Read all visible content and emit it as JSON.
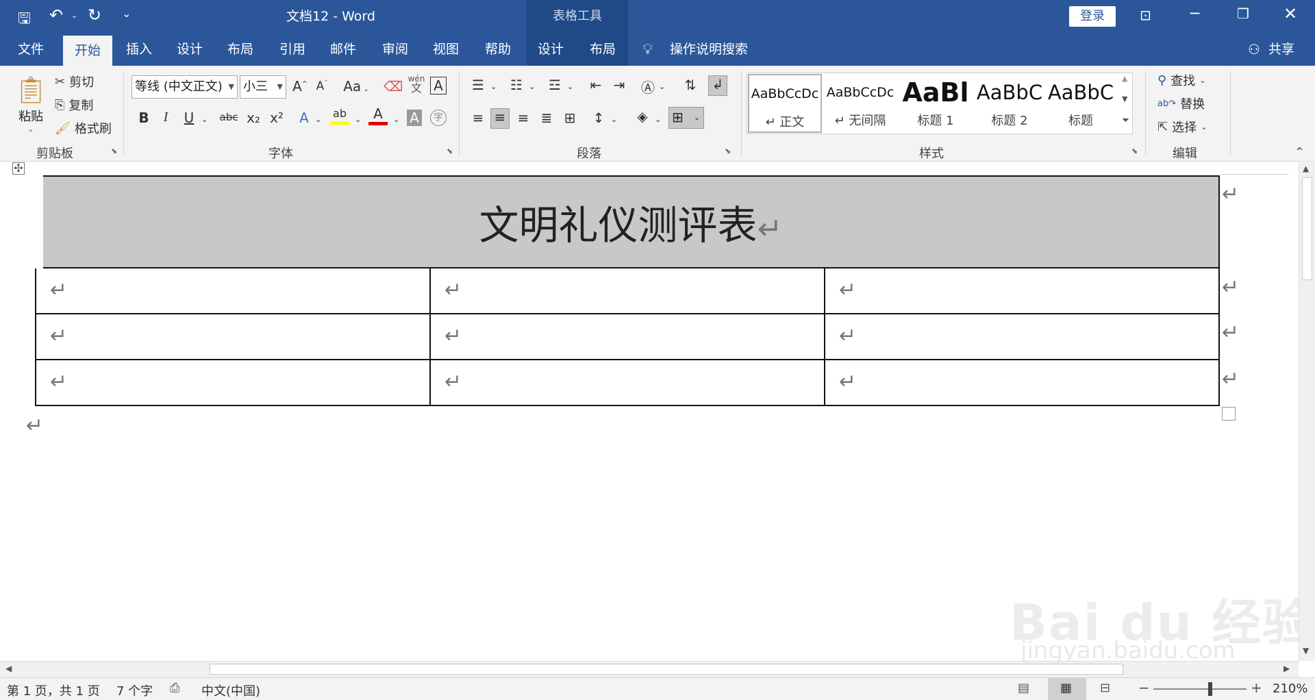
{
  "titlebar": {
    "title": "文档12  -  Word",
    "context_group": "表格工具",
    "login": "登录"
  },
  "tabs": [
    {
      "label": "文件"
    },
    {
      "label": "开始"
    },
    {
      "label": "插入"
    },
    {
      "label": "设计"
    },
    {
      "label": "布局"
    },
    {
      "label": "引用"
    },
    {
      "label": "邮件"
    },
    {
      "label": "审阅"
    },
    {
      "label": "视图"
    },
    {
      "label": "帮助"
    },
    {
      "label": "设计"
    },
    {
      "label": "布局"
    }
  ],
  "tell_me": "操作说明搜索",
  "share": "共享",
  "clipboard": {
    "paste": "粘贴",
    "cut": "剪切",
    "copy": "复制",
    "format_painter": "格式刷",
    "label": "剪贴板"
  },
  "font": {
    "name": "等线 (中文正文)",
    "size": "小三",
    "label": "字体",
    "change_case": "Aa",
    "phonetic_top": "wén",
    "phonetic_bottom": "文",
    "bold": "B",
    "italic": "I",
    "underline": "U",
    "strike": "abc",
    "sub": "x₂",
    "sup": "x²",
    "char_border": "A",
    "char_shading": "A",
    "encircle": "字"
  },
  "paragraph": {
    "label": "段落"
  },
  "styles": {
    "label": "样式",
    "items": [
      {
        "preview": "AaBbCcDc",
        "name": "↵ 正文"
      },
      {
        "preview": "AaBbCcDc",
        "name": "↵ 无间隔"
      },
      {
        "preview": "AaBl",
        "name": "标题 1"
      },
      {
        "preview": "AaBbC",
        "name": "标题 2"
      },
      {
        "preview": "AaBbC",
        "name": "标题"
      }
    ]
  },
  "editing": {
    "find": "查找",
    "replace": "替换",
    "select": "选择",
    "label": "编辑"
  },
  "document": {
    "title_cell": "文明礼仪测评表",
    "mark": "↵"
  },
  "status": {
    "page": "第 1 页，共 1 页",
    "words": "7 个字",
    "language": "中文(中国)",
    "zoom": "210%"
  },
  "watermark": {
    "text": "Bai du 经验",
    "url": "jingyan.baidu.com"
  },
  "colors": {
    "brand": "#2b579a",
    "context_tab": "#1f4a87",
    "highlight": "#ffff00",
    "font_color": "#e00000"
  }
}
